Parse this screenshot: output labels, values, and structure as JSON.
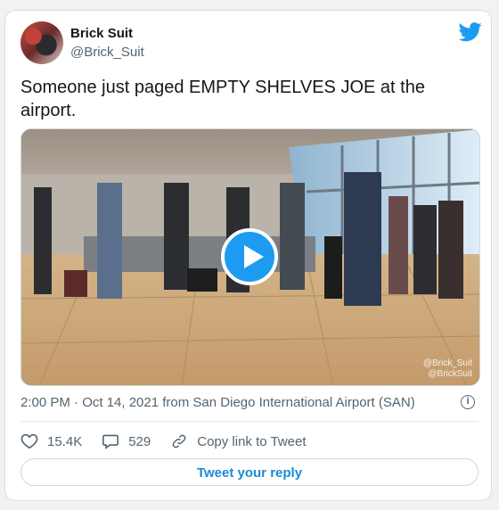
{
  "author": {
    "display_name": "Brick Suit",
    "handle": "@Brick_Suit",
    "avatar_icon": "profile-avatar"
  },
  "tweet": {
    "text": "Someone just paged EMPTY SHELVES JOE at the airport."
  },
  "media": {
    "type": "video",
    "play_icon": "play-icon",
    "watermark_line1": "@Brick_Suit",
    "watermark_line2": "@BrickSuit"
  },
  "meta": {
    "timestamp": "2:00 PM · Oct 14, 2021 from San Diego International Airport (SAN)",
    "info_icon": "info-icon"
  },
  "actions": {
    "like_count": "15.4K",
    "reply_count": "529",
    "copy_link_label": "Copy link to Tweet"
  },
  "reply_button_label": "Tweet your reply",
  "colors": {
    "brand": "#1d9bf0",
    "link": "#1b8ad8",
    "text": "#14171a",
    "muted": "#536471",
    "border": "#cfd9de"
  }
}
